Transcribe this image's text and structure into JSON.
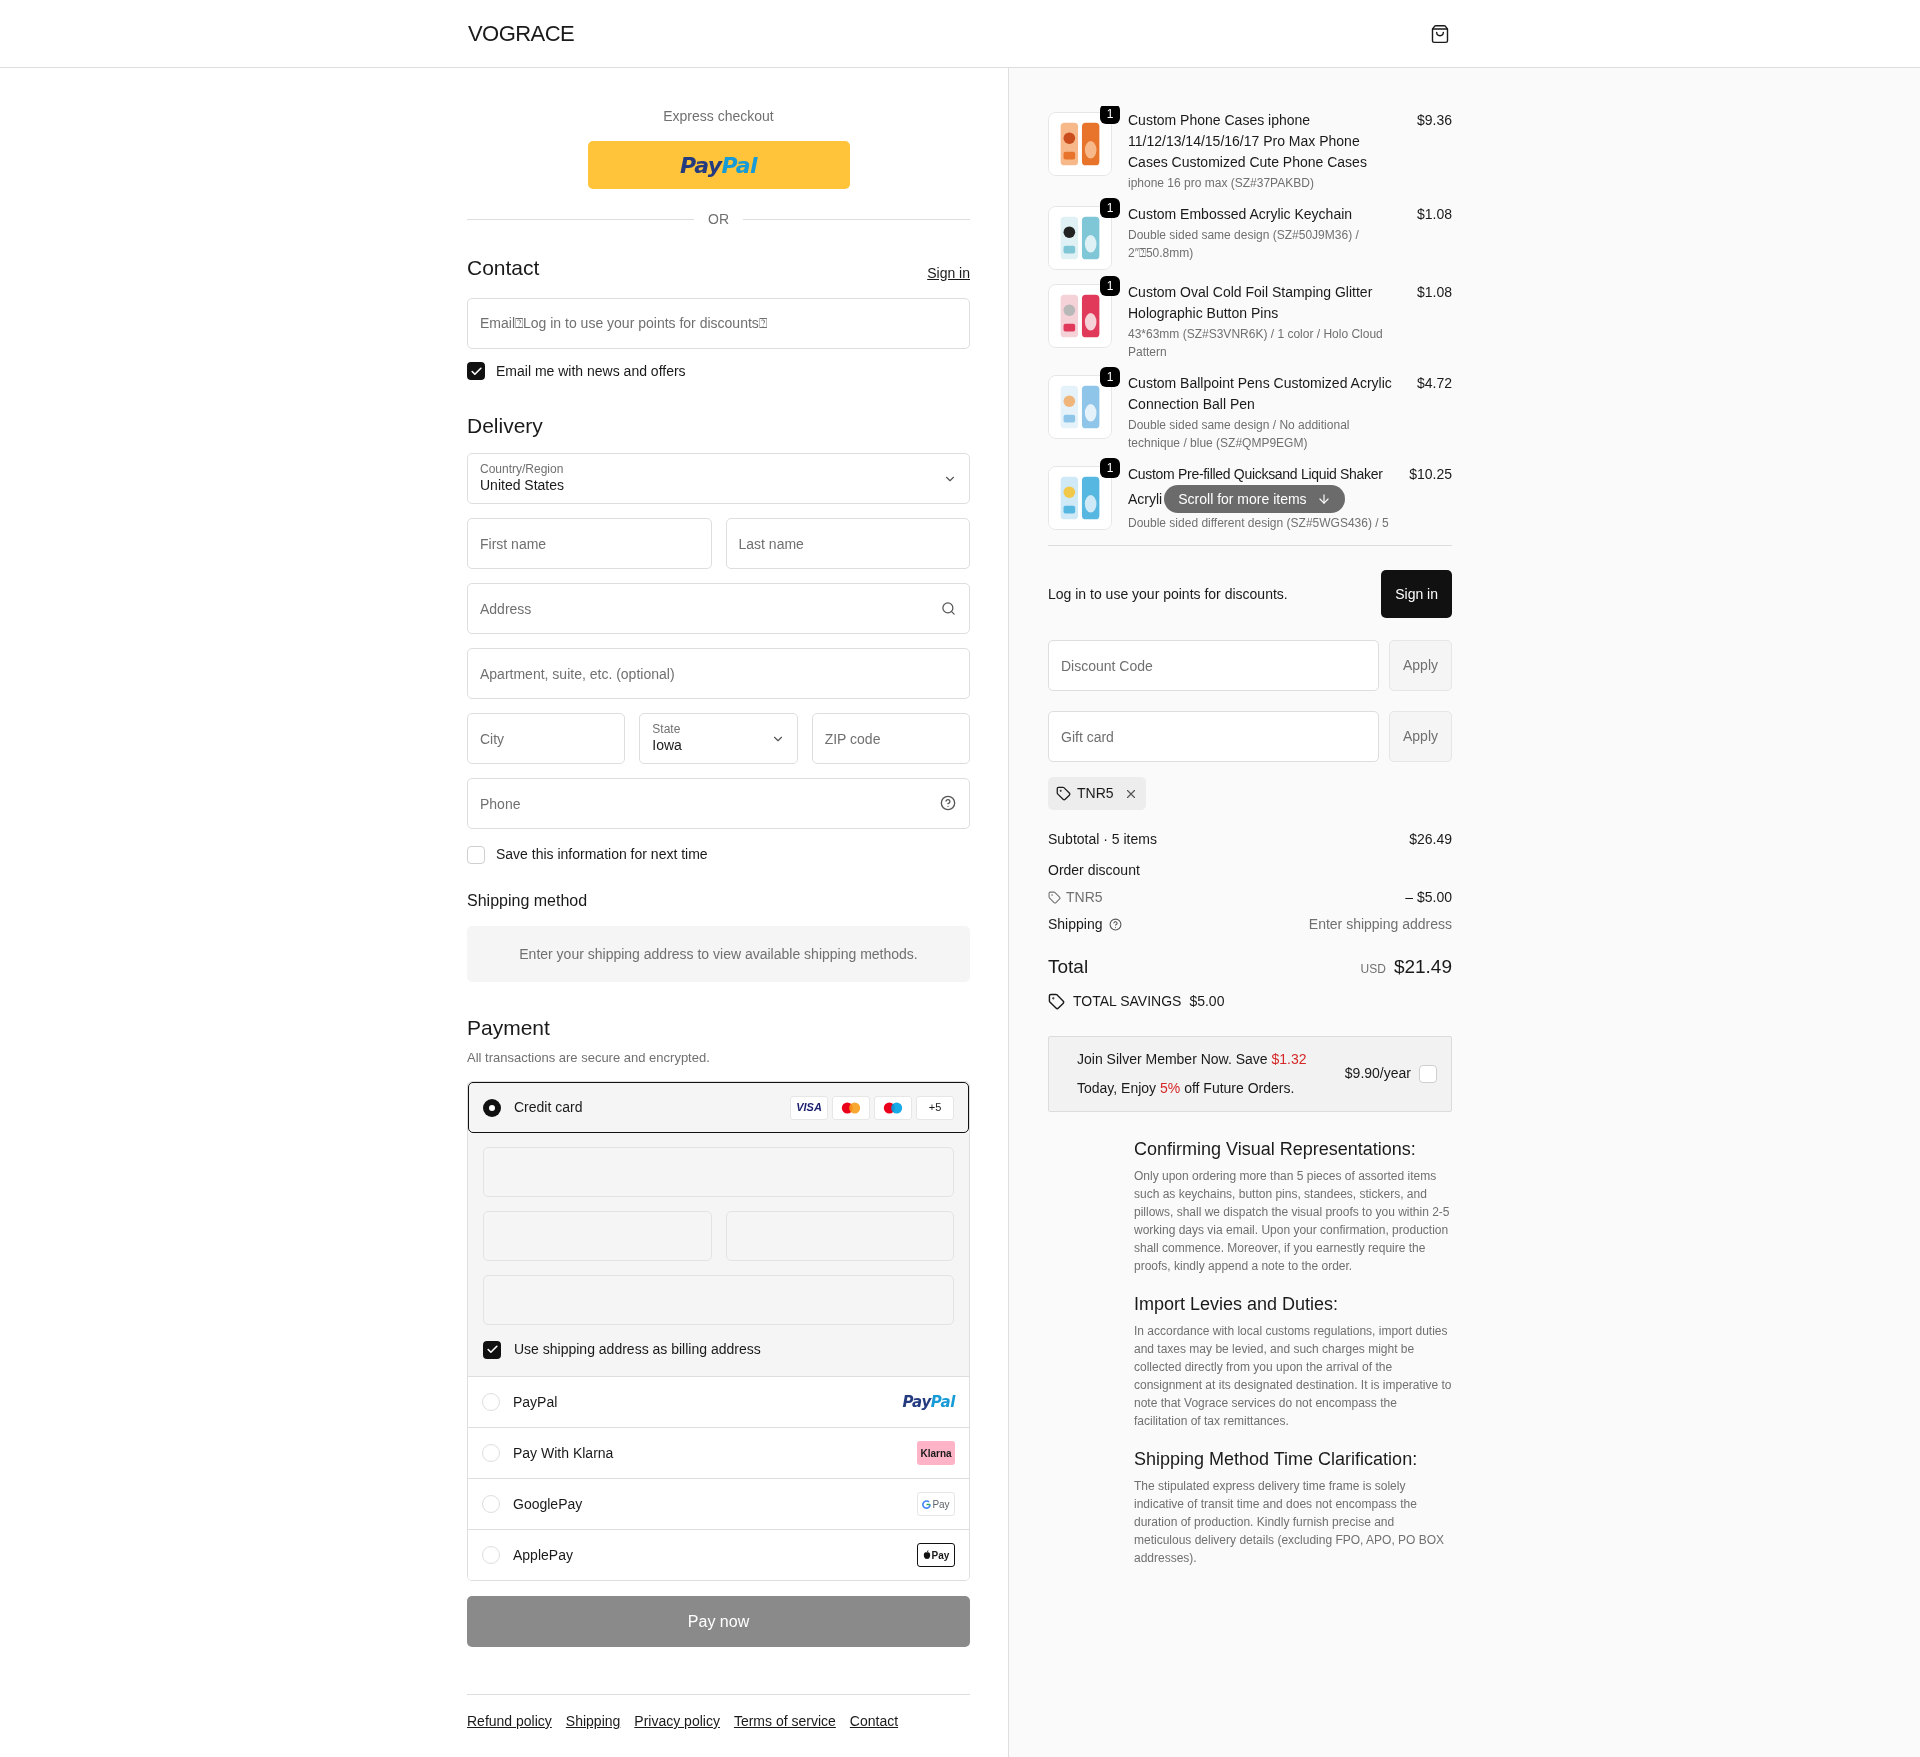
{
  "header": {
    "logo": "VOGRACE"
  },
  "express": {
    "label": "Express checkout",
    "paypal": [
      "Pay",
      "Pal"
    ],
    "or": "OR"
  },
  "contact": {
    "title": "Contact",
    "sign_in": "Sign in",
    "email_placeholder": "Email⍰Log in to use your points for discounts⍰",
    "news": {
      "label": "Email me with news and offers",
      "checked": true
    }
  },
  "delivery": {
    "title": "Delivery",
    "country": {
      "label": "Country/Region",
      "value": "United States"
    },
    "first_name": {
      "placeholder": "First name"
    },
    "last_name": {
      "placeholder": "Last name"
    },
    "address": {
      "placeholder": "Address"
    },
    "apartment": {
      "placeholder": "Apartment, suite, etc. (optional)"
    },
    "city": {
      "placeholder": "City"
    },
    "state": {
      "label": "State",
      "value": "Iowa"
    },
    "zip": {
      "placeholder": "ZIP code"
    },
    "phone": {
      "placeholder": "Phone"
    },
    "save": {
      "label": "Save this information for next time",
      "checked": false
    }
  },
  "shipping_method": {
    "title": "Shipping method",
    "message": "Enter your shipping address to view available shipping methods."
  },
  "payment": {
    "title": "Payment",
    "subtitle": "All transactions are secure and encrypted.",
    "methods": [
      {
        "kind": "card",
        "label": "Credit card",
        "selected": true,
        "more": "+5",
        "visa": "VISA"
      },
      {
        "kind": "paypal",
        "label": "PayPal",
        "selected": false,
        "logo": [
          "Pay",
          "Pal"
        ]
      },
      {
        "kind": "klarna",
        "label": "Pay With Klarna",
        "selected": false,
        "logo": "Klarna"
      },
      {
        "kind": "googlepay",
        "label": "GooglePay",
        "selected": false,
        "logo": "Pay"
      },
      {
        "kind": "applepay",
        "label": "ApplePay",
        "selected": false,
        "logo": "Pay"
      }
    ],
    "billing": {
      "label": "Use shipping address as billing address",
      "checked": true
    },
    "button": "Pay now"
  },
  "footer": [
    "Refund policy",
    "Shipping",
    "Privacy policy",
    "Terms of service",
    "Contact"
  ],
  "summary": {
    "items": [
      {
        "quantity": "1",
        "title": "Custom Phone Cases iphone 11/12/13/14/15/16/17 Pro Max Phone Cases Customized Cute Phone Cases",
        "variant": "iphone 16 pro max (SZ#37PAKBD)",
        "price": "$9.36"
      },
      {
        "quantity": "1",
        "title": "Custom Embossed Acrylic Keychain",
        "variant": "Double sided same design (SZ#50J9M36) / 2″⍰50.8mm)",
        "price": "$1.08"
      },
      {
        "quantity": "1",
        "title": "Custom Oval Cold Foil Stamping Glitter Holographic Button Pins",
        "variant": "43*63mm (SZ#S3VNR6K) / 1 color / Holo Cloud Pattern",
        "price": "$1.08"
      },
      {
        "quantity": "1",
        "title": "Custom Ballpoint Pens Customized Acrylic Connection Ball Pen",
        "variant": "Double sided same design / No additional technique / blue (SZ#QMP9EGM)",
        "price": "$4.72"
      },
      {
        "quantity": "1",
        "title": "Custom Pre-filled Quicksand Liquid Shaker",
        "title_cut": "Acryli",
        "variant": "Double sided different design (SZ#5WGS436) / 5",
        "price": "$10.25"
      }
    ],
    "scroll_hint": "Scroll for more items",
    "points": {
      "text": "Log in to use your points for discounts.",
      "button": "Sign in"
    },
    "discount": {
      "placeholder": "Discount Code",
      "button": "Apply"
    },
    "gift_card": {
      "placeholder": "Gift card",
      "button": "Apply"
    },
    "applied_code": "TNR5",
    "subtotal": {
      "label": "Subtotal · 5 items",
      "value": "$26.49"
    },
    "order_discount": {
      "label": "Order discount",
      "code": "TNR5",
      "value": "– $5.00"
    },
    "shipping": {
      "label": "Shipping",
      "value": "Enter shipping address"
    },
    "total": {
      "label": "Total",
      "currency": "USD",
      "value": "$21.49"
    },
    "savings": {
      "label": "TOTAL SAVINGS",
      "value": "$5.00"
    },
    "membership": {
      "lines": [
        [
          {
            "text": "Join Silver Member Now. Save ",
            "highlight": false
          },
          {
            "text": "$1.32",
            "highlight": true
          }
        ],
        [
          {
            "text": "Today, Enjoy ",
            "highlight": false
          },
          {
            "text": "5%",
            "highlight": true
          },
          {
            "text": " off Future Orders.",
            "highlight": false
          }
        ]
      ],
      "price": "$9.90/year",
      "checked": false
    },
    "notes": [
      {
        "title": "Confirming Visual Representations:",
        "body": "Only upon ordering more than 5 pieces of assorted items such as keychains, button pins, standees, stickers, and pillows, shall we dispatch the visual proofs to you within 2-5 working days via email. Upon your confirmation, production shall commence. Moreover, if you earnestly require the proofs, kindly append a note to the order."
      },
      {
        "title": "Import Levies and Duties:",
        "body": "In accordance with local customs regulations, import duties and taxes may be levied, and such charges might be collected directly from you upon the arrival of the consignment at its designated destination. It is imperative to note that Vograce services do not encompass the facilitation of tax remittances."
      },
      {
        "title": "Shipping Method Time Clarification:",
        "body": "The stipulated express delivery time frame is solely indicative of transit time and does not encompass the duration of production. Kindly furnish precise and meticulous delivery details (excluding FPO, APO, PO BOX addresses)."
      }
    ]
  }
}
